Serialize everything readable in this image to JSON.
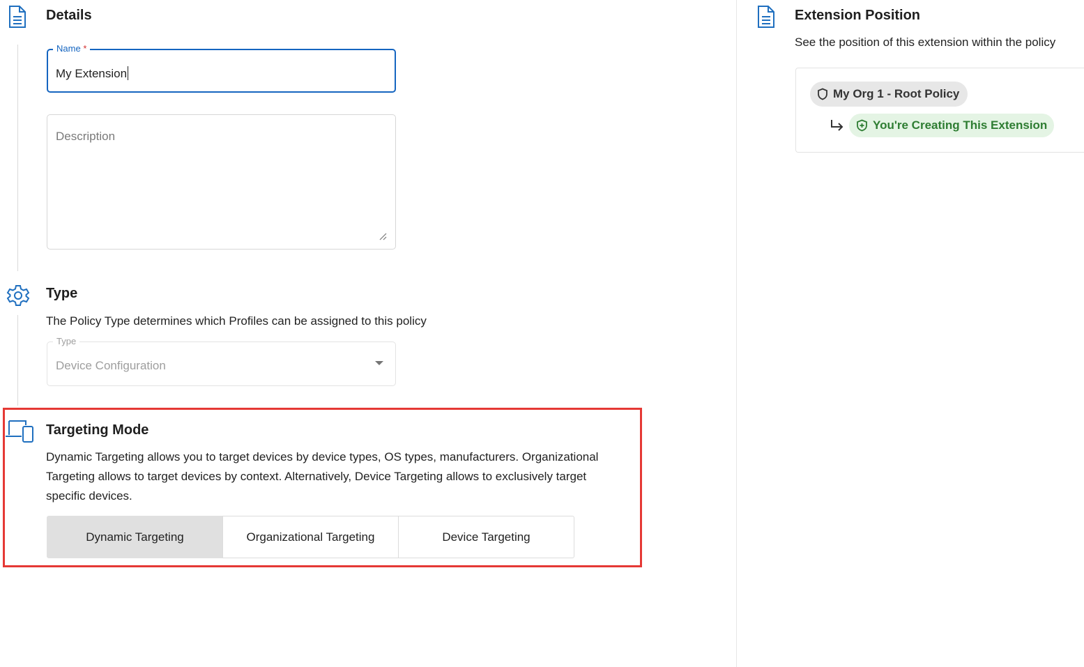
{
  "details": {
    "title": "Details",
    "name_label": "Name",
    "name_required": "*",
    "name_value": "My Extension",
    "description_placeholder": "Description"
  },
  "type": {
    "title": "Type",
    "description": "The Policy Type determines which Profiles can be assigned to this policy",
    "field_label": "Type",
    "field_value": "Device Configuration"
  },
  "targeting": {
    "title": "Targeting Mode",
    "description": "Dynamic Targeting allows you to target devices by device types, OS types, manufacturers. Organizational Targeting allows to target devices by context. Alternatively, Device Targeting allows to exclusively target specific devices.",
    "options": [
      "Dynamic Targeting",
      "Organizational Targeting",
      "Device Targeting"
    ],
    "selected": "Dynamic Targeting"
  },
  "extension_position": {
    "title": "Extension Position",
    "description": "See the position of this extension within the policy",
    "root_policy": "My Org 1 - Root Policy",
    "current": "You're Creating This Extension"
  },
  "colors": {
    "accent": "#1565c0",
    "highlight": "#e53935",
    "success": "#2e7d32"
  }
}
